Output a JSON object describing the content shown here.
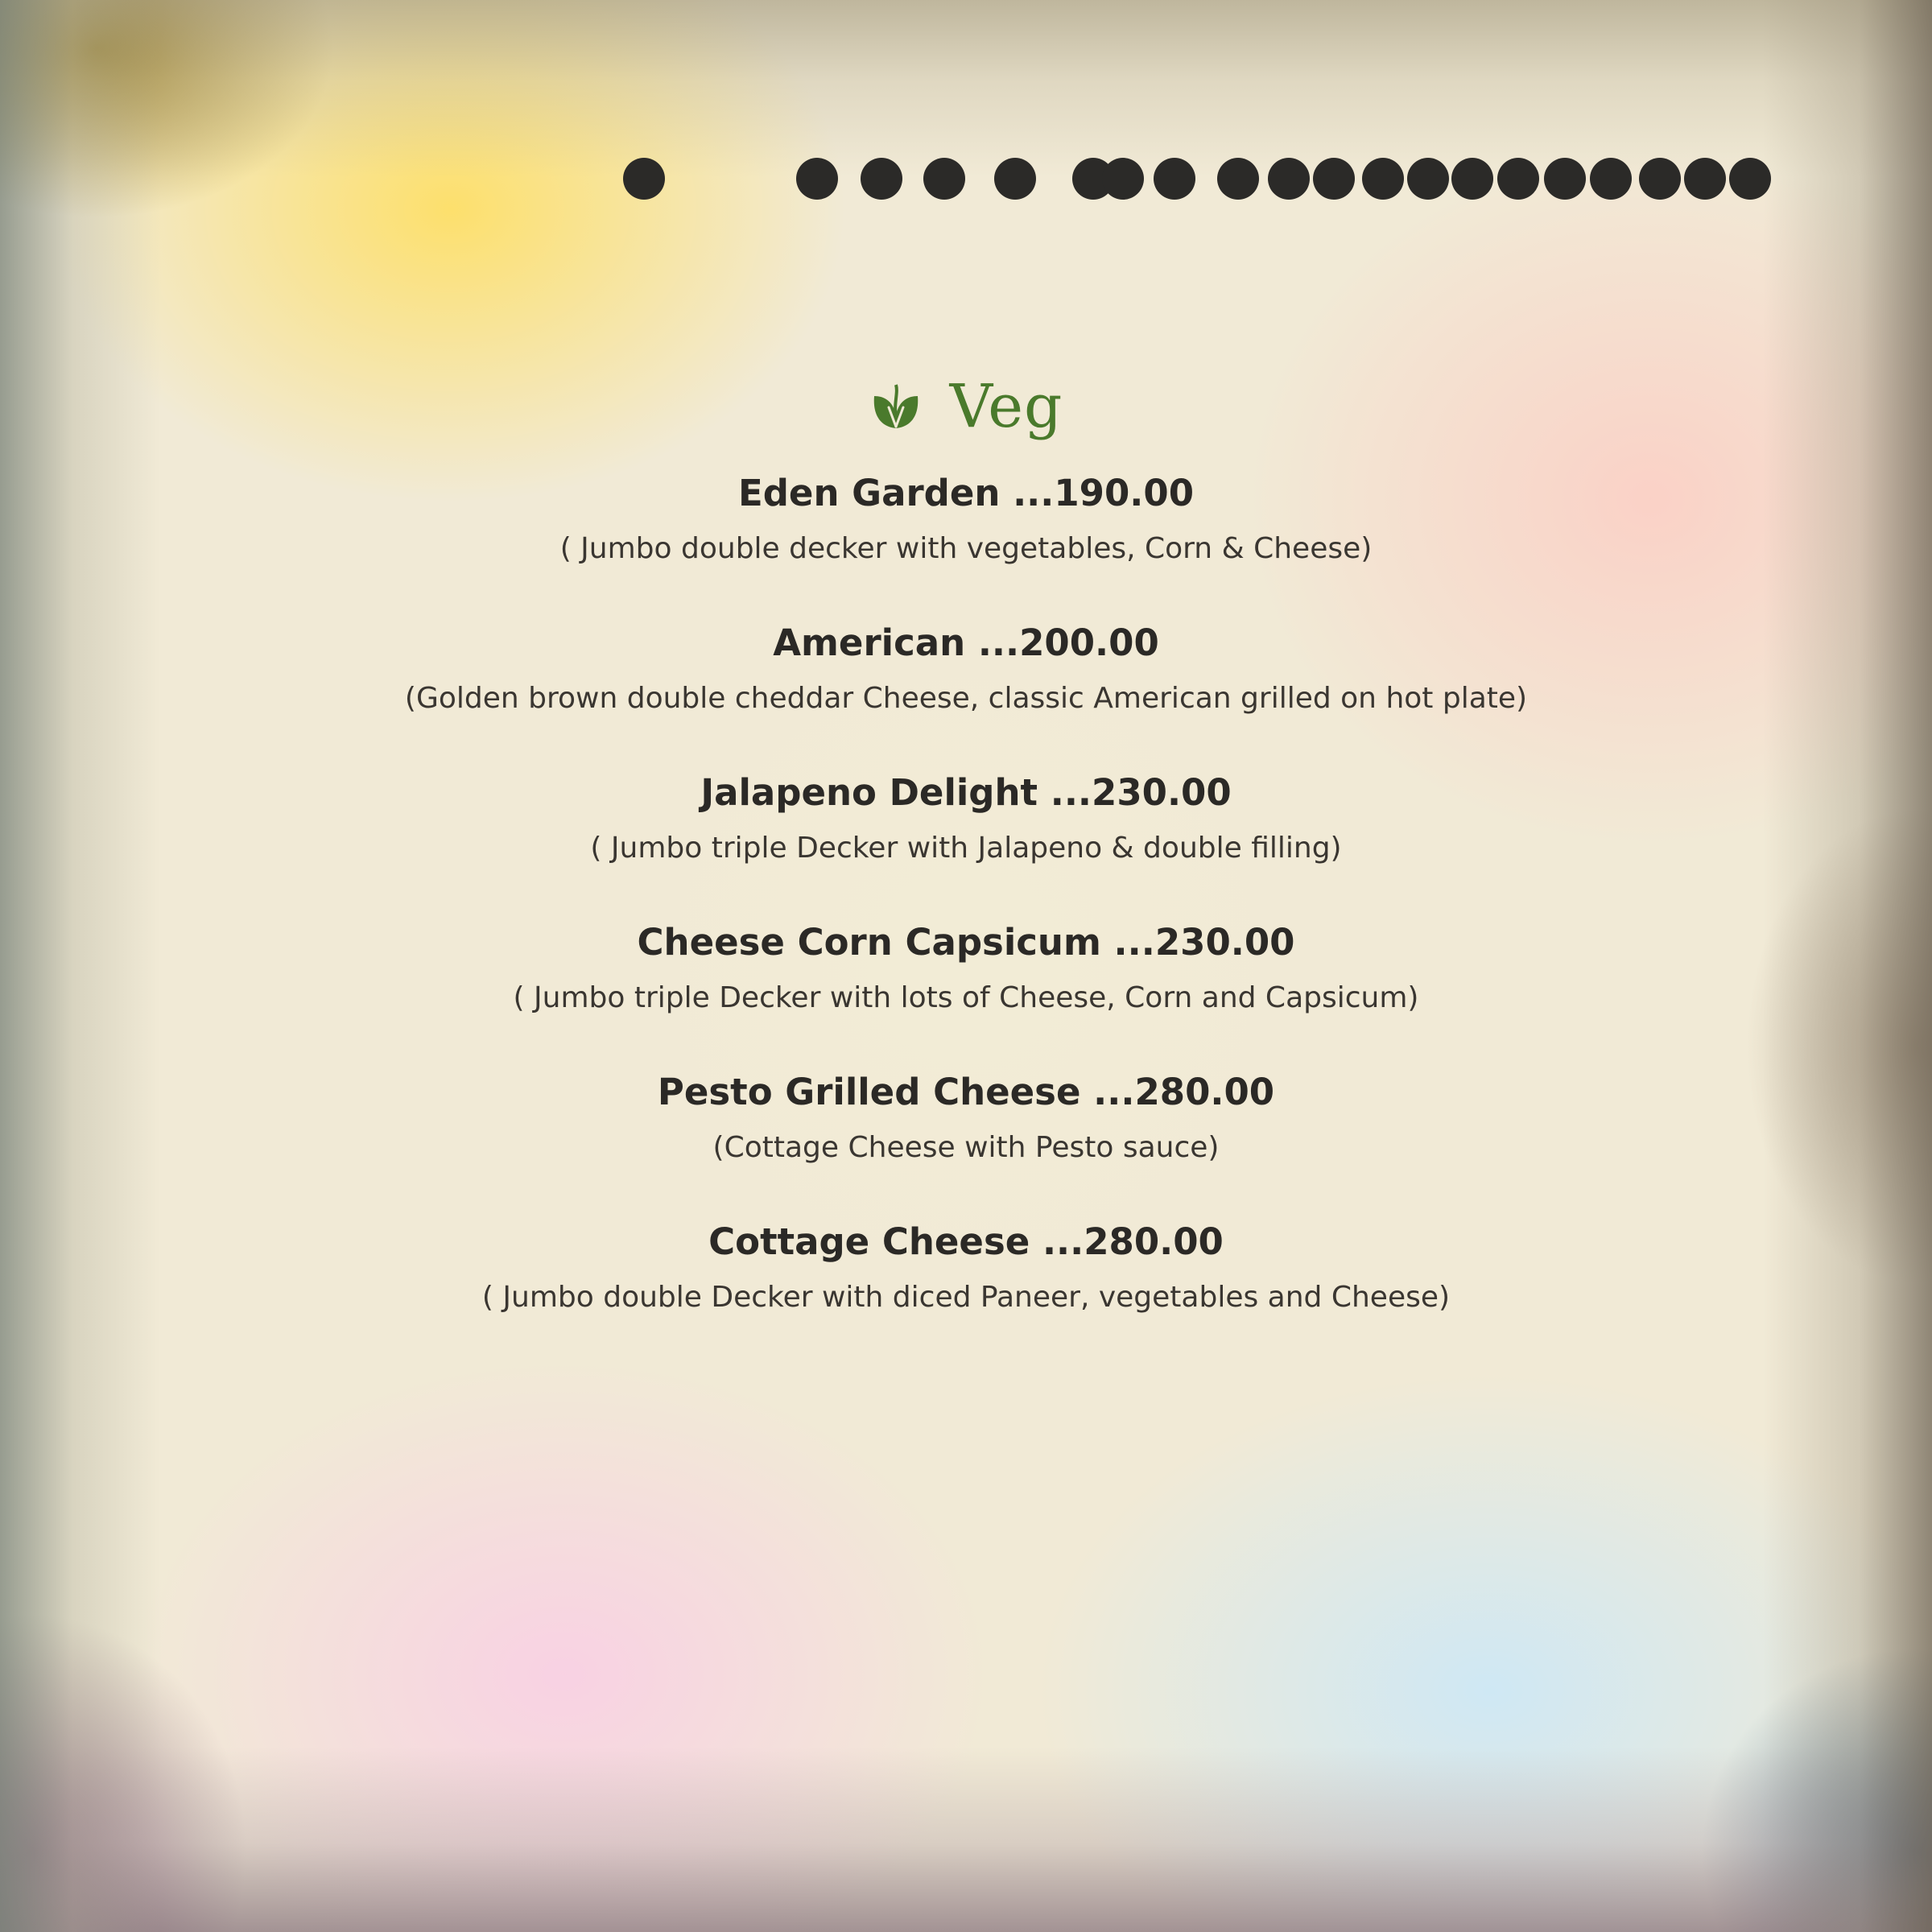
{
  "menu": {
    "section": {
      "title": "Veg",
      "icon": "leaf-icon",
      "accent_color": "#4a7a2c"
    },
    "items": [
      {
        "name": "Eden Garden",
        "price": "...190.00",
        "description": "( Jumbo double decker with vegetables, Corn & Cheese)"
      },
      {
        "name": "American",
        "price": "...200.00",
        "description": "(Golden brown double cheddar Cheese, classic American grilled on hot plate)"
      },
      {
        "name": "Jalapeno Delight",
        "price": "...230.00",
        "description": "( Jumbo triple Decker with Jalapeno & double filling)"
      },
      {
        "name": "Cheese Corn Capsicum",
        "price": "...230.00",
        "description": "( Jumbo triple Decker with lots of Cheese, Corn and Capsicum)"
      },
      {
        "name": "Pesto Grilled Cheese",
        "price": "...280.00",
        "description": "(Cottage Cheese with Pesto sauce)"
      },
      {
        "name": "Cottage Cheese",
        "price": "...280.00",
        "description": "( Jumbo double Decker with diced Paneer, vegetables and Cheese)"
      }
    ]
  },
  "decoration": {
    "dot_color": "#2b2a28"
  }
}
